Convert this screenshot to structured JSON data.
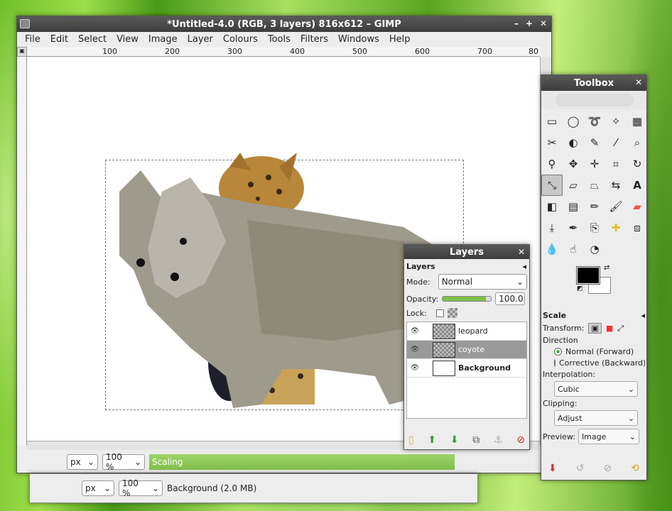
{
  "main": {
    "title": "*Untitled-4.0 (RGB, 3 layers) 816x612 – GIMP",
    "menu": [
      "File",
      "Edit",
      "Select",
      "View",
      "Image",
      "Layer",
      "Colours",
      "Tools",
      "Filters",
      "Windows",
      "Help"
    ],
    "ruler_ticks": [
      "100",
      "200",
      "300",
      "400",
      "500",
      "600",
      "700",
      "80"
    ],
    "unit": "px",
    "zoom": "100 %",
    "status": "Scaling",
    "progress": 1.0
  },
  "second_window": {
    "unit": "px",
    "zoom": "100 %",
    "status": "Background (2.0 MB)"
  },
  "layers": {
    "window_title": "Layers",
    "tab": "Layers",
    "mode_label": "Mode:",
    "mode": "Normal",
    "opacity_label": "Opacity:",
    "opacity": "100.0",
    "lock_label": "Lock:",
    "items": [
      {
        "name": "leopard",
        "selected": false,
        "bold": false
      },
      {
        "name": "coyote",
        "selected": true,
        "bold": false
      },
      {
        "name": "Background",
        "selected": false,
        "bold": true
      }
    ]
  },
  "toolbox": {
    "title": "Toolbox",
    "options_title": "Scale",
    "transform_label": "Transform:",
    "direction_label": "Direction",
    "dir_normal": "Normal (Forward)",
    "dir_corrective": "Corrective (Backward)",
    "interp_label": "Interpolation:",
    "interp": "Cubic",
    "clipping_label": "Clipping:",
    "clipping": "Adjust",
    "preview_label": "Preview:",
    "preview": "Image",
    "fg_color": "#000000",
    "bg_color": "#ffffff"
  }
}
